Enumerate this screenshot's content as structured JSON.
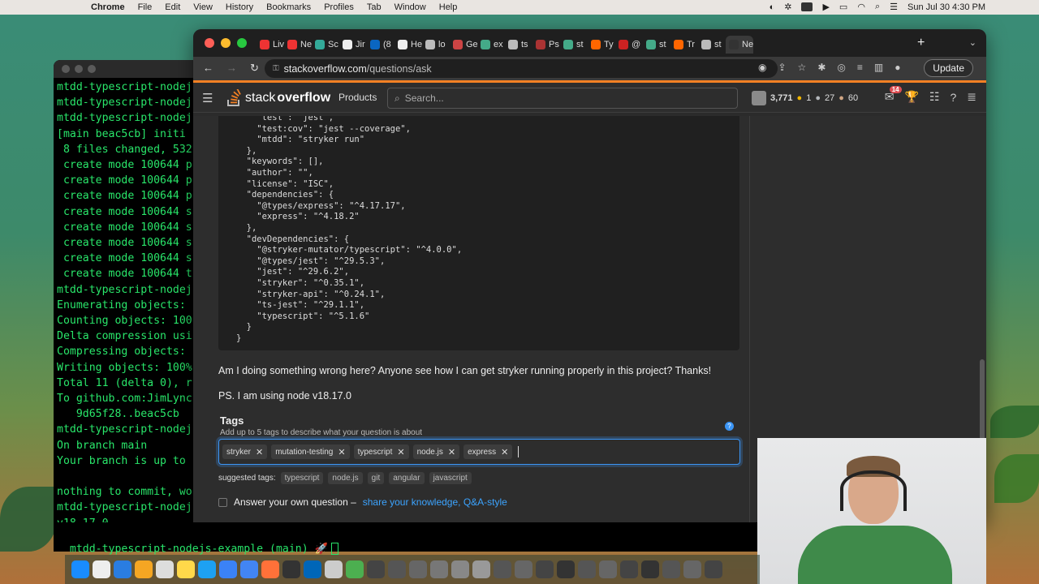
{
  "menubar": {
    "app": "Chrome",
    "menus": [
      "File",
      "Edit",
      "View",
      "History",
      "Bookmarks",
      "Profiles",
      "Tab",
      "Window",
      "Help"
    ],
    "datetime": "Sun Jul 30  4:30 PM"
  },
  "terminal": {
    "lines": [
      "mtdd-typescript-nodej",
      "mtdd-typescript-nodej",
      "mtdd-typescript-nodej",
      "[main beac5cb] initi",
      " 8 files changed, 532",
      " create mode 100644 p",
      " create mode 100644 p",
      " create mode 100644 p",
      " create mode 100644 s",
      " create mode 100644 s",
      " create mode 100644 s",
      " create mode 100644 s",
      " create mode 100644 t",
      "mtdd-typescript-nodej",
      "Enumerating objects:",
      "Counting objects: 100",
      "Delta compression usi",
      "Compressing objects:",
      "Writing objects: 100%",
      "Total 11 (delta 0), r",
      "To github.com:JimLync",
      "   9d65f28..beac5cb",
      "mtdd-typescript-nodej",
      "On branch main",
      "Your branch is up to",
      "",
      "nothing to commit, wo",
      "mtdd-typescript-nodej",
      "v18.17.0"
    ],
    "prompt": "mtdd-typescript-nodejs-example (main) 🚀"
  },
  "browser": {
    "tabs": [
      {
        "label": "Liv",
        "color": "#e33"
      },
      {
        "label": "Ne",
        "color": "#e33"
      },
      {
        "label": "Sc",
        "color": "#3a9"
      },
      {
        "label": "Jir",
        "color": "#eee"
      },
      {
        "label": "(8",
        "color": "#0a66c2"
      },
      {
        "label": "He",
        "color": "#eee"
      },
      {
        "label": "lo",
        "color": "#bbb"
      },
      {
        "label": "Ge",
        "color": "#c44"
      },
      {
        "label": "ex",
        "color": "#4a8"
      },
      {
        "label": "ts",
        "color": "#bbb"
      },
      {
        "label": "Ps",
        "color": "#a33"
      },
      {
        "label": "st",
        "color": "#4a8"
      },
      {
        "label": "Ty",
        "color": "#f60"
      },
      {
        "label": "@",
        "color": "#c22"
      },
      {
        "label": "st",
        "color": "#4a8"
      },
      {
        "label": "Tr",
        "color": "#f60"
      },
      {
        "label": "st",
        "color": "#bbb"
      },
      {
        "label": "Ne",
        "color": "#333"
      }
    ],
    "url_host": "stackoverflow.com",
    "url_path": "/questions/ask",
    "update_label": "Update"
  },
  "so": {
    "logo_light": "stack",
    "logo_bold": "overflow",
    "products": "Products",
    "search_placeholder": "Search...",
    "reputation": "3,771",
    "gold": "1",
    "silver": "27",
    "bronze": "60",
    "inbox_count": "14"
  },
  "question": {
    "code_lines": [
      "    \"test\": \"jest\",",
      "    \"test:cov\": \"jest --coverage\",",
      "    \"mtdd\": \"stryker run\"",
      "  },",
      "  \"keywords\": [],",
      "  \"author\": \"\",",
      "  \"license\": \"ISC\",",
      "  \"dependencies\": {",
      "    \"@types/express\": \"^4.17.17\",",
      "    \"express\": \"^4.18.2\"",
      "  },",
      "  \"devDependencies\": {",
      "    \"@stryker-mutator/typescript\": \"^4.0.0\",",
      "    \"@types/jest\": \"^29.5.3\",",
      "    \"jest\": \"^29.6.2\",",
      "    \"stryker\": \"^0.35.1\",",
      "    \"stryker-api\": \"^0.24.1\",",
      "    \"ts-jest\": \"^29.1.1\",",
      "    \"typescript\": \"^5.1.6\"",
      "  }",
      "}"
    ],
    "body_line1": "Am I doing something wrong here? Anyone see how I can get stryker running properly in this project? Thanks!",
    "body_line2": "PS. I am using node v18.17.0",
    "tags_title": "Tags",
    "tags_help": "Add up to 5 tags to describe what your question is about",
    "tags": [
      "stryker",
      "mutation-testing",
      "typescript",
      "node.js",
      "express"
    ],
    "suggested_label": "suggested tags:",
    "suggested": [
      "typescript",
      "node.js",
      "git",
      "angular",
      "javascript"
    ],
    "answer_own_label": "Answer your own question –",
    "answer_own_link": "share your knowledge, Q&A-style"
  },
  "icons": {
    "apple": "apple-icon",
    "search": "search-icon",
    "hamburger": "hamburger-icon"
  }
}
